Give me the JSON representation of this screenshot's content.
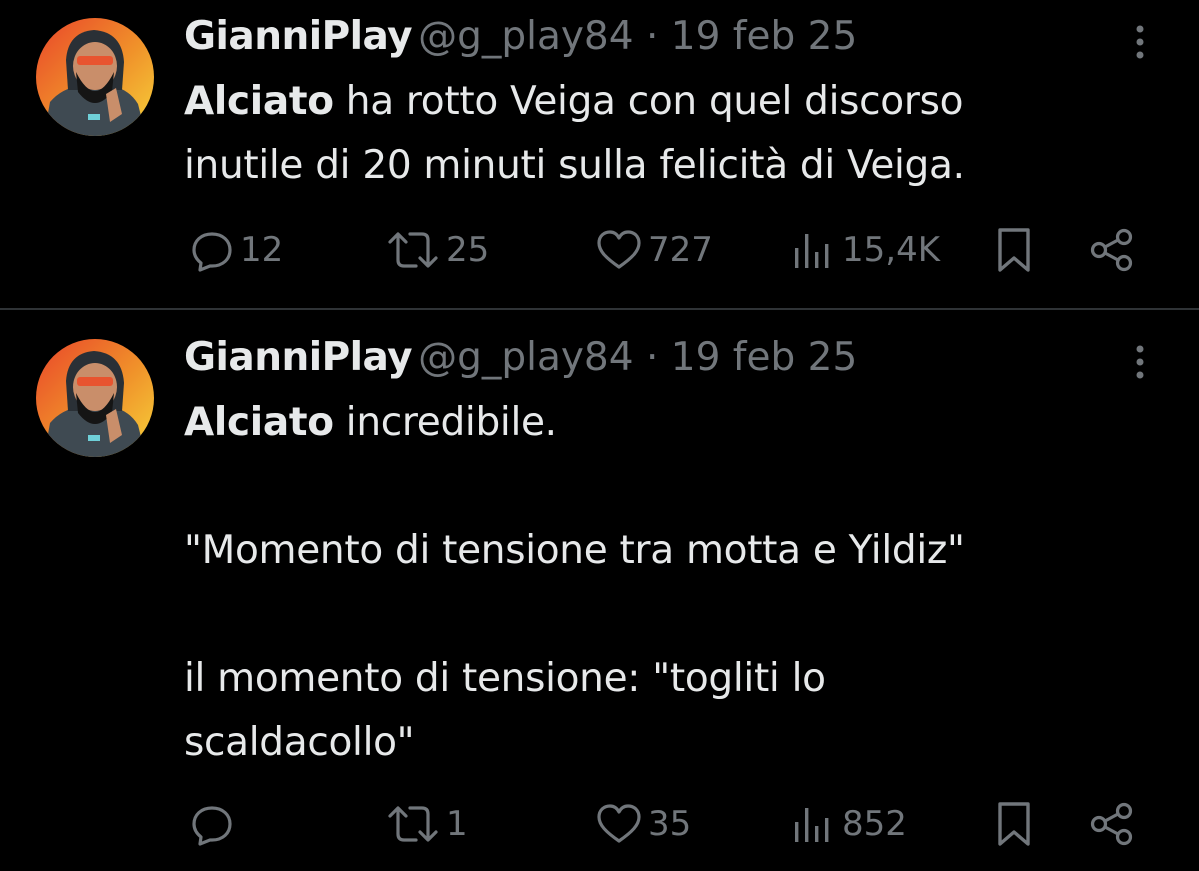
{
  "colors": {
    "background": "#000000",
    "primary_text": "#e7e9ea",
    "secondary_text": "#71767b",
    "divider": "#2f3336"
  },
  "tweets": [
    {
      "author": {
        "display_name": "GianniPlay",
        "handle": "@g_play84"
      },
      "separator": "·",
      "date": "19 feb 25",
      "mention": "Alciato",
      "body_paragraphs": [
        " ha rotto Veiga con quel discorso inutile di 20 minuti sulla felicità di Veiga."
      ],
      "counts": {
        "replies": "12",
        "reposts": "25",
        "likes": "727",
        "views": "15,4K"
      },
      "icons": [
        "reply-icon",
        "repost-icon",
        "like-icon",
        "views-icon",
        "bookmark-icon",
        "share-icon",
        "more-icon"
      ]
    },
    {
      "author": {
        "display_name": "GianniPlay",
        "handle": "@g_play84"
      },
      "separator": "·",
      "date": "19 feb 25",
      "mention": "Alciato",
      "body_paragraphs": [
        " incredibile.",
        "\"Momento di tensione tra motta e Yildiz\"",
        "il momento di tensione: \"togliti lo",
        "scaldacollo\""
      ],
      "counts": {
        "replies": "",
        "reposts": "1",
        "likes": "35",
        "views": "852"
      },
      "icons": [
        "reply-icon",
        "repost-icon",
        "like-icon",
        "views-icon",
        "bookmark-icon",
        "share-icon",
        "more-icon"
      ]
    }
  ]
}
